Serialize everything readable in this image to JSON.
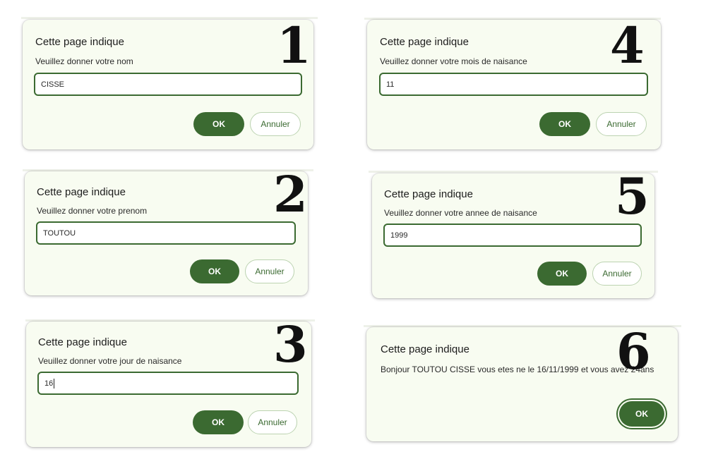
{
  "dialogs": [
    {
      "number": "1",
      "title": "Cette page indique",
      "message": "Veuillez donner votre nom",
      "value": "CISSE",
      "ok": "OK",
      "cancel": "Annuler"
    },
    {
      "number": "2",
      "title": "Cette page indique",
      "message": "Veuillez donner votre prenom",
      "value": "TOUTOU",
      "ok": "OK",
      "cancel": "Annuler"
    },
    {
      "number": "3",
      "title": "Cette page indique",
      "message": "Veuillez donner votre jour de naisance",
      "value": "16",
      "ok": "OK",
      "cancel": "Annuler"
    },
    {
      "number": "4",
      "title": "Cette page indique",
      "message": "Veuillez donner votre mois de naisance",
      "value": "11",
      "ok": "OK",
      "cancel": "Annuler"
    },
    {
      "number": "5",
      "title": "Cette page indique",
      "message": "Veuillez donner votre annee de naisance",
      "value": "1999",
      "ok": "OK",
      "cancel": "Annuler"
    },
    {
      "number": "6",
      "title": "Cette page indique",
      "message": "Bonjour TOUTOU CISSE vous etes ne le 16/11/1999 et vous avez 24ans",
      "ok": "OK"
    }
  ],
  "colors": {
    "accent": "#3b6a31",
    "dialog_bg": "#f8fcf1"
  }
}
